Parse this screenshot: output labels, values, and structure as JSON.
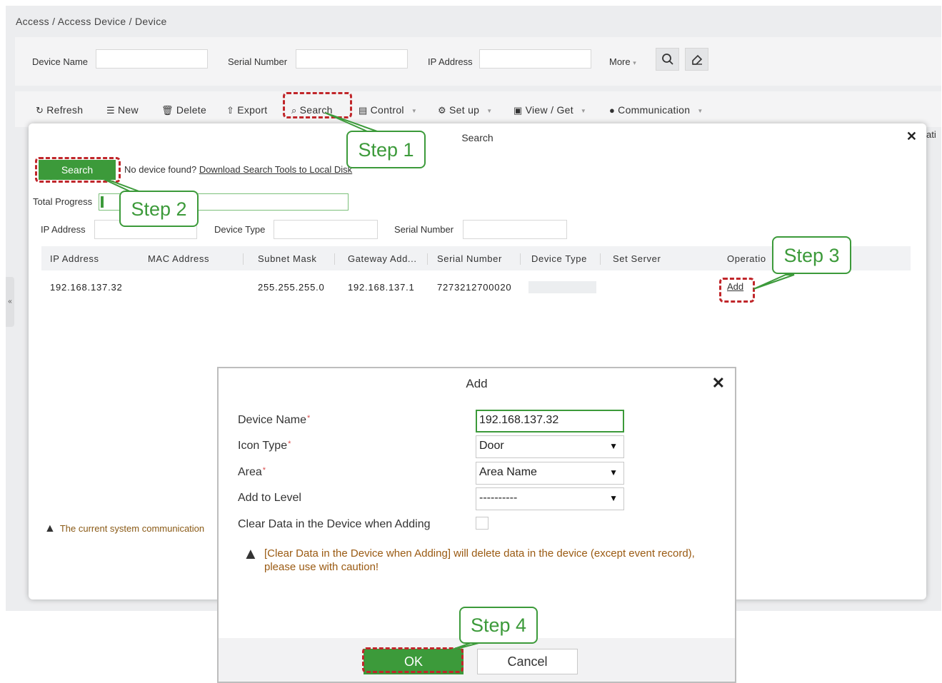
{
  "breadcrumb": "Access / Access Device / Device",
  "filters": {
    "device_name_label": "Device Name",
    "serial_number_label": "Serial Number",
    "ip_address_label": "IP Address",
    "more_label": "More",
    "more_caret": "▾",
    "search_icon": "search-icon",
    "clear_icon": "eraser-icon"
  },
  "toolbar": {
    "refresh": "Refresh",
    "new": "New",
    "delete": "Delete",
    "export": "Export",
    "search": "Search",
    "control": "Control",
    "setup": "Set up",
    "view_get": "View / Get",
    "communication": "Communication"
  },
  "peek_text": "ati",
  "search_dialog": {
    "title": "Search",
    "search_button": "Search",
    "no_device_text": "No device found?",
    "download_link": "Download Search Tools to Local Disk",
    "total_progress_label": "Total Progress",
    "ip_label": "IP Address",
    "device_type_label": "Device Type",
    "serial_label": "Serial Number",
    "columns": [
      "IP Address",
      "MAC Address",
      "Subnet Mask",
      "Gateway Add...",
      "Serial Number",
      "Device Type",
      "Set Server",
      "Operatio"
    ],
    "row": {
      "ip": "192.168.137.32",
      "mac": "",
      "subnet": "255.255.255.0",
      "gateway": "192.168.137.1",
      "serial": "7273212700020",
      "operation": "Add"
    },
    "warning": "The current system communication"
  },
  "add_dialog": {
    "title": "Add",
    "fields": {
      "device_name_label": "Device Name",
      "device_name_value": "192.168.137.32",
      "icon_type_label": "Icon Type",
      "icon_type_value": "Door",
      "area_label": "Area",
      "area_value": "Area Name",
      "level_label": "Add to Level",
      "level_value": "----------",
      "clear_label": "Clear Data in the Device when Adding"
    },
    "required_mark": "*",
    "warning": "[Clear Data in the Device when Adding] will delete data in the device (except event record), please use with caution!",
    "ok": "OK",
    "cancel": "Cancel"
  },
  "steps": [
    "Step 1",
    "Step 2",
    "Step 3",
    "Step 4"
  ],
  "colors": {
    "accent": "#3c9a3a",
    "highlight": "#c0262a",
    "warning": "#9a5a12"
  }
}
